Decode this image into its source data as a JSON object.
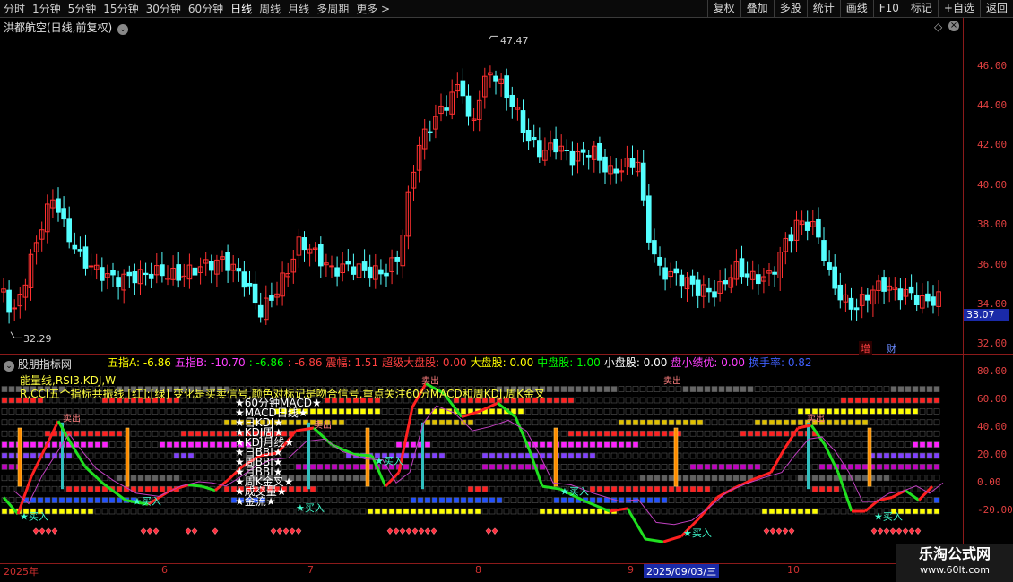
{
  "toolbar": {
    "periods": [
      "分时",
      "1分钟",
      "5分钟",
      "15分钟",
      "30分钟",
      "60分钟",
      "日线",
      "周线",
      "月线",
      "多周期",
      "更多 >"
    ],
    "active_period": "日线",
    "buttons": [
      "复权",
      "叠加",
      "多股",
      "统计",
      "画线",
      "F10",
      "标记",
      "+自选",
      "返回"
    ]
  },
  "chart_title": "洪都航空(日线,前复权)",
  "price_axis": [
    "46.00",
    "44.00",
    "42.00",
    "40.00",
    "38.00",
    "36.00",
    "34.00",
    "32.00"
  ],
  "current_price": "33.07",
  "high_label": "47.47",
  "low_label": "32.29",
  "markers": [
    "增",
    "财"
  ],
  "indicator_title": "股朋指标网",
  "indicator_header": [
    {
      "label": "五指A:",
      "value": "-6.86",
      "color": "#ffff00"
    },
    {
      "label": "五指B:",
      "value": "-10.70",
      "color": "#ff40ff"
    },
    {
      "label": ":",
      "value": "-6.86",
      "color": "#00ff00"
    },
    {
      "label": ":",
      "value": "-6.86",
      "color": "#ff4040"
    },
    {
      "label": "震幅:",
      "value": "1.51",
      "color": "#ff4040"
    },
    {
      "label": "超级大盘股:",
      "value": "0.00",
      "color": "#ff4040"
    },
    {
      "label": "大盘股:",
      "value": "0.00",
      "color": "#ffff00"
    },
    {
      "label": "中盘股:",
      "value": "1.00",
      "color": "#00ff00"
    },
    {
      "label": "小盘股:",
      "value": "0.00",
      "color": "#ffffff"
    },
    {
      "label": "盘小绩优:",
      "value": "0.00",
      "color": "#ff40ff"
    },
    {
      "label": "换手率:",
      "value": "0.82",
      "color": "#4060ff"
    }
  ],
  "indicator_axis": [
    "80.00",
    "60.00",
    "40.00",
    "20.00",
    "0.00",
    "-20.00"
  ],
  "text_line1": "能量线,RSI3.KDJ,W",
  "text_line2": "R,CCI五个指标共振线,[红]:[绿] 变化是买卖信号,颜色对标记是吻合信号,重点关注60分MACD和周KDJ,周K金叉",
  "legend_items": [
    "★60分钟MACD★",
    "★MACD日线★",
    "★日KDJ★",
    "★KDJ周★",
    "★KDJ月线★",
    "★日BBI★",
    "★周BBI★",
    "★月BBI★",
    "★周K金叉★",
    "★成交量★",
    "★金流★"
  ],
  "buy_label": "买入",
  "sell_label": "卖出",
  "dates": [
    "2025年",
    "6",
    "7",
    "8",
    "9",
    "2025/09/03/三",
    "10"
  ],
  "watermark": {
    "line1": "乐淘公式网",
    "line2": "www.60lt.com"
  },
  "colors": {
    "up": "#ff3030",
    "down": "#54ffff",
    "axis": "#e04040"
  }
}
